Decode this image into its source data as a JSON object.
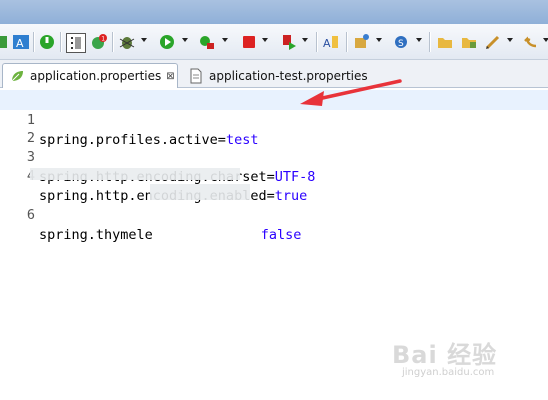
{
  "tabs": [
    {
      "label": "application.properties",
      "close": "⊠",
      "active": true
    },
    {
      "label": "application-test.properties",
      "active": false
    }
  ],
  "toolbar_icons": [
    "new-icon",
    "text-format-icon",
    "debug-stop-icon",
    "select-icon",
    "refresh-badge-icon",
    "bug-icon",
    "run-icon",
    "run-config-icon",
    "stop-icon",
    "external-tool-icon",
    "text-search-icon",
    "new-package-icon",
    "settings-icon",
    "open-folder-icon",
    "open-folder-icon",
    "edit-icon",
    "back-icon"
  ],
  "editor": {
    "lines": [
      {
        "num": "1",
        "key": "spring.profiles.active=",
        "value": "test",
        "current": true
      },
      {
        "num": "2",
        "key": "",
        "value": ""
      },
      {
        "num": "3",
        "key": "spring.http.encoding.charset=",
        "value": "UTF-8"
      },
      {
        "num": "4",
        "key": "spring.http.encoding.enabled=",
        "value": "true"
      },
      {
        "num": "6",
        "key": "spring.thymele",
        "value": "false"
      }
    ]
  },
  "colors": {
    "key": "#000000",
    "value": "#2a00ff",
    "current_line": "#e8f2fe",
    "annotation_arrow": "#e8333a"
  },
  "watermark": {
    "brand": "Bai 经验",
    "sub": "jingyan.baidu.com"
  }
}
